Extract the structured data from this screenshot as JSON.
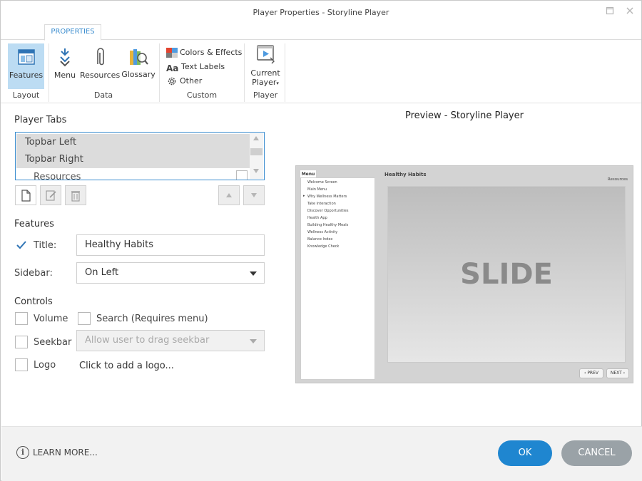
{
  "window": {
    "title": "Player Properties - Storyline Player"
  },
  "ribbon": {
    "tab": "PROPERTIES",
    "layout": {
      "label": "Layout",
      "features": "Features"
    },
    "data": {
      "label": "Data",
      "menu": "Menu",
      "resources": "Resources",
      "glossary": "Glossary"
    },
    "custom": {
      "label": "Custom",
      "colors": "Colors & Effects",
      "text_labels": "Text Labels",
      "other": "Other"
    },
    "player": {
      "label": "Player",
      "current_player_line1": "Current",
      "current_player_line2": "Player"
    }
  },
  "player_tabs": {
    "heading": "Player Tabs",
    "items": [
      {
        "label": "Topbar Left"
      },
      {
        "label": "Topbar Right"
      },
      {
        "label": "Resources"
      }
    ]
  },
  "features": {
    "heading": "Features",
    "title_label": "Title:",
    "title_checked": true,
    "title_value": "Healthy Habits",
    "sidebar_label": "Sidebar:",
    "sidebar_value": "On Left"
  },
  "controls": {
    "heading": "Controls",
    "volume": "Volume",
    "search": "Search (Requires menu)",
    "seekbar": "Seekbar",
    "seekbar_option": "Allow user to drag seekbar",
    "logo": "Logo",
    "logo_prompt": "Click to add a logo..."
  },
  "preview": {
    "heading": "Preview - Storyline Player",
    "menu_tab": "Menu",
    "course_title": "Healthy Habits",
    "resources": "Resources",
    "menu_items": [
      "Welcome Screen",
      "Main Menu",
      "Why Wellness Matters",
      "Take Interaction",
      "Discover Opportunities",
      "Health App",
      "Building Healthy Meals",
      "Wellness Activity",
      "Balance Index",
      "Knowledge Check"
    ],
    "slide_text": "SLIDE",
    "prev": "PREV",
    "next": "NEXT"
  },
  "footer": {
    "learn_more": "LEARN MORE...",
    "ok": "OK",
    "cancel": "CANCEL"
  },
  "colors": {
    "accent": "#3b8dcf",
    "ok_button": "#1f86d0",
    "cancel_button": "#9aa2a7",
    "selected_button": "#bcdcf3"
  }
}
